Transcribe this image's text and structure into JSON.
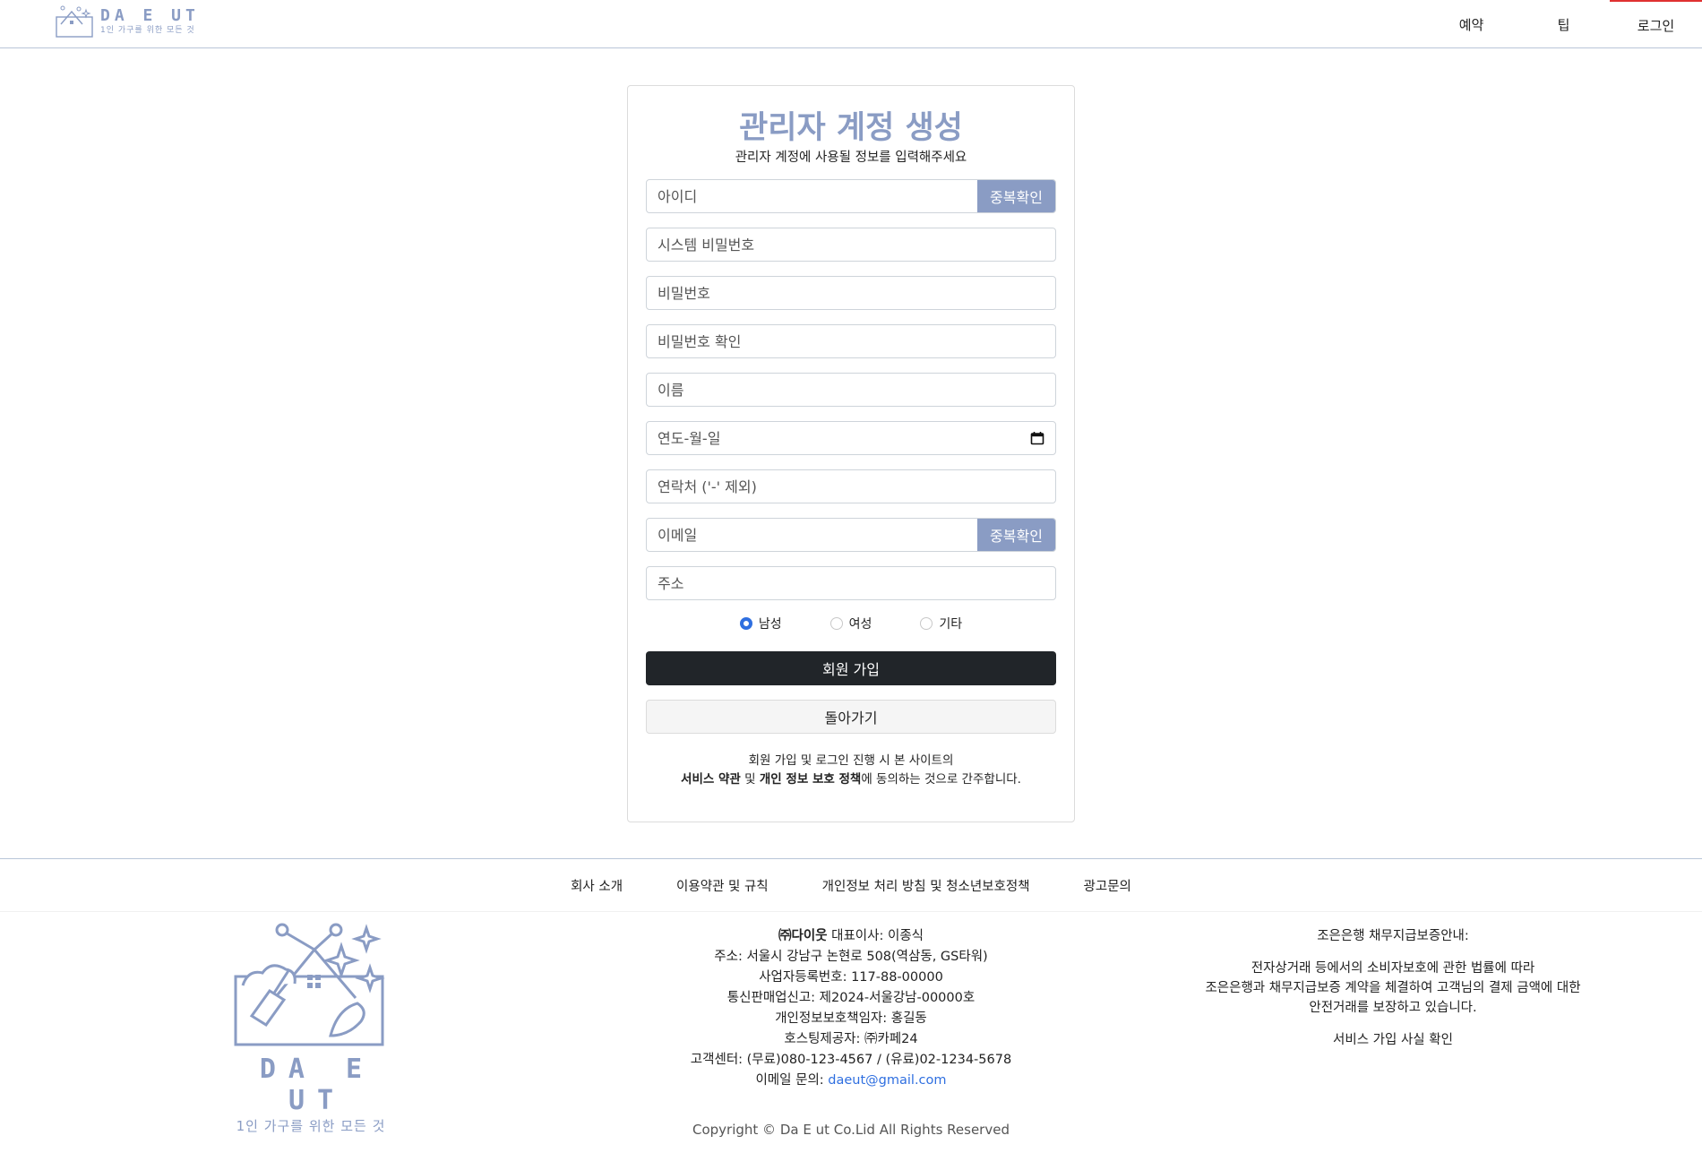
{
  "header": {
    "logo_title": "DA E UT",
    "logo_sub": "1인 가구를 위한 모든 것",
    "nav": [
      "예약",
      "팁",
      "로그인"
    ]
  },
  "form": {
    "title": "관리자 계정 생성",
    "description": "관리자 계정에 사용될 정보를 입력해주세요",
    "username_placeholder": "아이디",
    "dup_check_label": "중복확인",
    "system_password_placeholder": "시스템 비밀번호",
    "password_placeholder": "비밀번호",
    "password_confirm_placeholder": "비밀번호 확인",
    "name_placeholder": "이름",
    "birth_placeholder": "연도-월-일",
    "phone_placeholder": "연락처 ('-' 제외)",
    "email_placeholder": "이메일",
    "email_dup_check_label": "중복확인",
    "address_placeholder": "주소",
    "gender_options": [
      "남성",
      "여성",
      "기타"
    ],
    "gender_selected": "남성",
    "join_button": "회원 가입",
    "back_button": "돌아가기",
    "notice_line1": "회원 가입 및 로그인 진행 시 본 사이트의",
    "notice_terms": "서비스 약관",
    "notice_and": " 및 ",
    "notice_privacy": "개인 정보 보호 정책",
    "notice_end": "에 동의하는 것으로 간주합니다."
  },
  "footer": {
    "links": [
      "회사 소개",
      "이용약관 및 규칙",
      "개인정보 처리 방침 및 청소년보호정책",
      "광고문의"
    ],
    "logo_title": "DA E UT",
    "logo_sub": "1인 가구를 위한 모든 것",
    "company_name": "㈜다이웃",
    "ceo": " 대표이사: 이종식",
    "address": "주소: 서울시 강남구 논현로 508(역삼동, GS타워)",
    "business_no": "사업자등록번호: 117-88-00000",
    "mail_order": "통신판매업신고: 제2024-서울강남-00000호",
    "privacy_officer": "개인정보보호책임자: 홍길동",
    "hosting": "호스팅제공자: ㈜카페24",
    "customer_center": "고객센터: (무료)080-123-4567 / (유료)02-1234-5678",
    "email_label": "이메일 문의: ",
    "email": "daeut@gmail.com",
    "guarantee_title": "조은은행 채무지급보증안내:",
    "guarantee_line1": "전자상거래 등에서의 소비자보호에 관한 법률에 따라",
    "guarantee_line2": "조은은행과 채무지급보증 계약을 체결하여 고객님의 결제 금액에 대한",
    "guarantee_line3": "안전거래를 보장하고 있습니다.",
    "guarantee_link": "서비스 가입 사실 확인",
    "copyright": "Copyright © Da E ut Co.Lid All Rights Reserved"
  },
  "colors": {
    "accent": "#8a9cc4",
    "dark_button": "#212529",
    "radio_selected": "#2f6fe0",
    "nav_active_border": "#e03131"
  }
}
